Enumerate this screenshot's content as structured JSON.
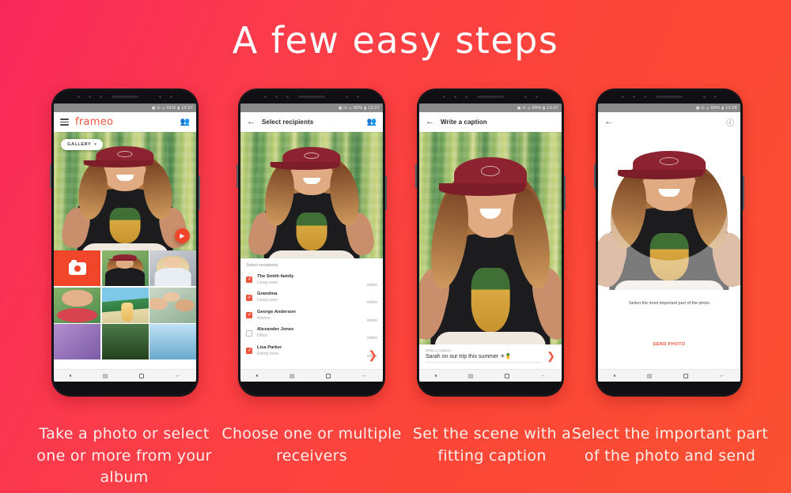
{
  "headline": "A few easy steps",
  "theme": {
    "bg_start": "#F9285C",
    "bg_end": "#FB5032",
    "accent": "#F2553D",
    "accent_strong": "#F2462B",
    "caption_color": "#FFEDE9"
  },
  "phones": [
    {
      "id": "phone-gallery",
      "statusbar": {
        "icons": "▣ ⛁ ⊿",
        "battery": "91%",
        "time": "13.07"
      },
      "appbar": {
        "menu_icon": "hamburger-icon",
        "brand": "frameo",
        "action_icon": "add-person-icon"
      },
      "photo_overlay": {
        "gallery_label": "GALLERY",
        "caret": "▾",
        "play_icon": "▶"
      },
      "gallery": {
        "camera_tile": "camera-icon",
        "tiles": [
          "photo-girl-green-wall",
          "photo-girl-confetti",
          "photo-watermelon",
          "photo-beach-drink",
          "photo-family-selfie",
          "photo-purple",
          "photo-landscape",
          "photo-sky"
        ]
      },
      "navbar": {
        "recents": "▤",
        "home": "□",
        "back": "←"
      },
      "caption": "Take a photo or select one or more from your album"
    },
    {
      "id": "phone-recipients",
      "statusbar": {
        "icons": "▣ ⛁ ⊿",
        "battery": "90%",
        "time": "13.07"
      },
      "appbar": {
        "back_icon": "←",
        "title": "Select recipients",
        "action_icon": "add-person-icon"
      },
      "list_title": "Select recipients",
      "recipients": [
        {
          "name": "The Smith family",
          "room": "Living room",
          "status": "online",
          "checked": true
        },
        {
          "name": "Grandma",
          "room": "Living room",
          "status": "online",
          "checked": true
        },
        {
          "name": "George Anderson",
          "room": "Kitchen",
          "status": "online",
          "checked": true
        },
        {
          "name": "Alexander Jones",
          "room": "Office",
          "status": "online",
          "checked": false
        },
        {
          "name": "Lisa Parker",
          "room": "Dining room",
          "status": "online",
          "checked": true
        }
      ],
      "next_icon": "❯",
      "caption": "Choose one or multiple receivers"
    },
    {
      "id": "phone-caption",
      "statusbar": {
        "icons": "▣ ⛁ ⊿",
        "battery": "90%",
        "time": "13.07"
      },
      "appbar": {
        "back_icon": "←",
        "title": "Write a caption"
      },
      "caption_field": {
        "label": "Write a caption",
        "value": "Sarah on our trip this summer ☀🍍",
        "placeholder": "Write a caption"
      },
      "send_icon": "❯",
      "caption": "Set the scene with a fitting caption"
    },
    {
      "id": "phone-crop",
      "statusbar": {
        "icons": "▣ ⛁ ⊿",
        "battery": "90%",
        "time": "13.08"
      },
      "appbar": {
        "back_icon": "←",
        "help_icon": "?"
      },
      "crop_hint": "Select the most important part of the photo",
      "send_label": "SEND PHOTO",
      "caption": "Select the important part of the photo and send"
    }
  ]
}
